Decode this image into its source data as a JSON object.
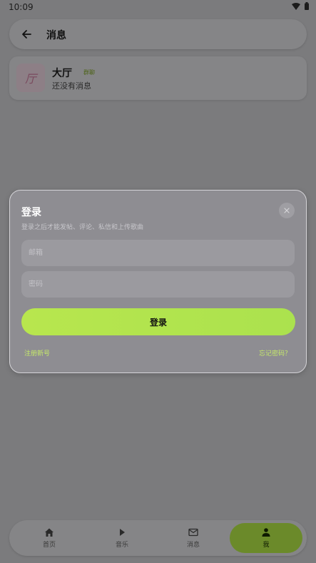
{
  "status_bar": {
    "time": "10:09"
  },
  "header": {
    "title": "消息"
  },
  "chat_room": {
    "avatar_char": "厅",
    "name": "大厅",
    "badge": "群聊",
    "last_message": "还没有消息"
  },
  "login_dialog": {
    "title": "登录",
    "subtitle": "登录之后才能发帖、评论、私信和上传歌曲",
    "email_placeholder": "邮箱",
    "password_placeholder": "密码",
    "login_button": "登录",
    "register_link": "注册新号",
    "forgot_link": "忘记密码？"
  },
  "bottom_nav": {
    "items": [
      {
        "label": "首页",
        "icon": "home-icon"
      },
      {
        "label": "音乐",
        "icon": "play-icon"
      },
      {
        "label": "消息",
        "icon": "mail-icon"
      },
      {
        "label": "我",
        "icon": "person-icon",
        "active": true
      }
    ]
  },
  "colors": {
    "accent": "#b8e64e",
    "active_tab": "#6b8a2a"
  }
}
